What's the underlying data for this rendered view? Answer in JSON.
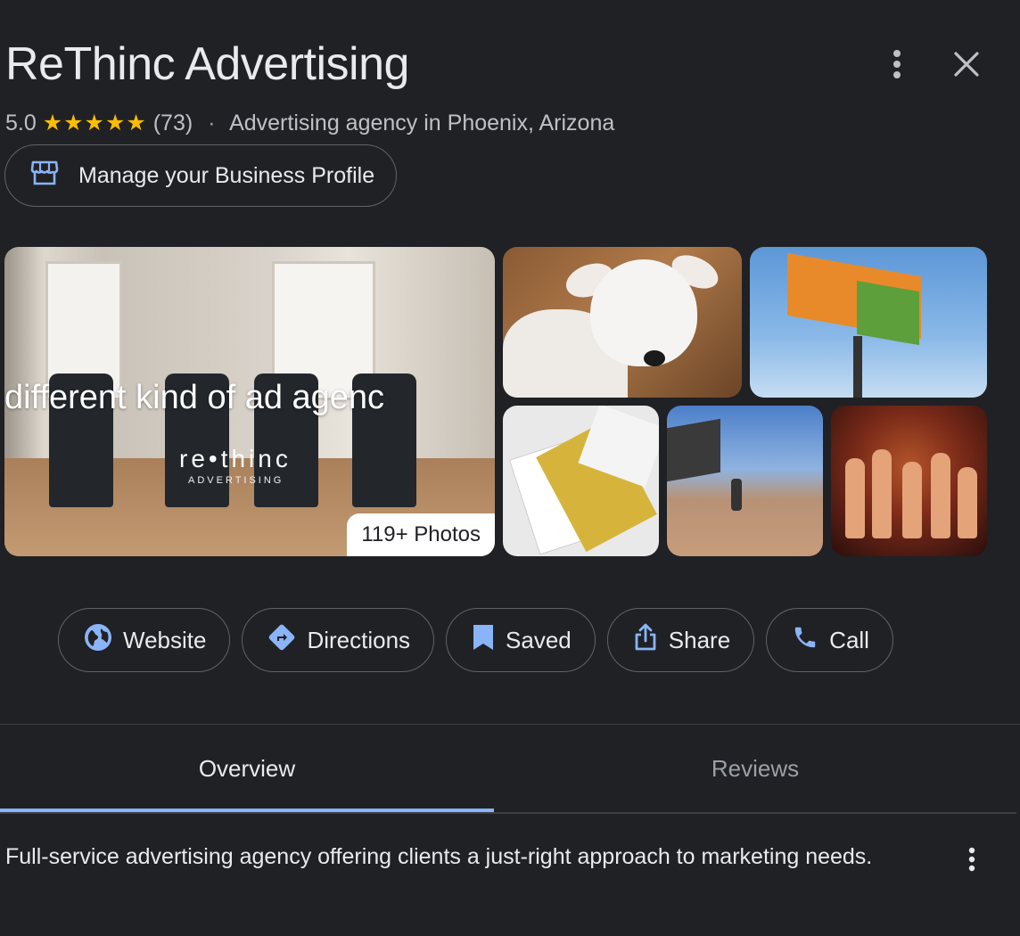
{
  "business": {
    "name": "ReThinc Advertising",
    "rating": "5.0",
    "stars": "★★★★★",
    "review_count": "(73)",
    "separator": "·",
    "category": "Advertising agency in Phoenix, Arizona"
  },
  "manage_profile": {
    "label": "Manage your Business Profile",
    "icon": "storefront-icon"
  },
  "photos": {
    "main_overlay_text": "different kind of ad agenc",
    "main_logo": "re•thinc",
    "main_logo_sub": "ADVERTISING",
    "count_label": "119+ Photos"
  },
  "actions": [
    {
      "label": "Website",
      "icon": "globe-icon"
    },
    {
      "label": "Directions",
      "icon": "directions-icon"
    },
    {
      "label": "Saved",
      "icon": "bookmark-icon"
    },
    {
      "label": "Share",
      "icon": "share-icon"
    },
    {
      "label": "Call",
      "icon": "phone-icon"
    }
  ],
  "tabs": {
    "overview": "Overview",
    "reviews": "Reviews",
    "active": "Overview"
  },
  "description": "Full-service advertising agency offering clients a just-right approach to marketing needs.",
  "colors": {
    "background": "#202124",
    "accent": "#8ab4f8",
    "star": "#fbbc04",
    "text": "#e8eaed",
    "muted": "#9aa0a6"
  }
}
